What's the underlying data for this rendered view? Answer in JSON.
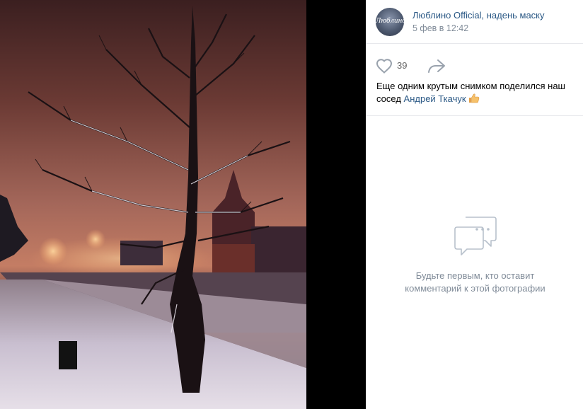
{
  "post": {
    "author": "Люблино Official, надень маску",
    "avatar_text": "Люблино",
    "date": "5 фев в 12:42",
    "likes": "39",
    "caption_text": "Еще одним крутым снимком поделился наш сосед ",
    "caption_link": "Андрей Ткачук",
    "caption_emoji": "thumbs-up"
  },
  "comments": {
    "empty_line1": "Будьте первым, кто оставит",
    "empty_line2": "комментарий к этой фотографии"
  },
  "icons": {
    "like": "heart-icon",
    "share": "share-arrow-icon",
    "empty": "speech-bubble-icon"
  },
  "colors": {
    "link": "#2a5885",
    "muted": "#818c99",
    "icon": "#99a2ad"
  }
}
